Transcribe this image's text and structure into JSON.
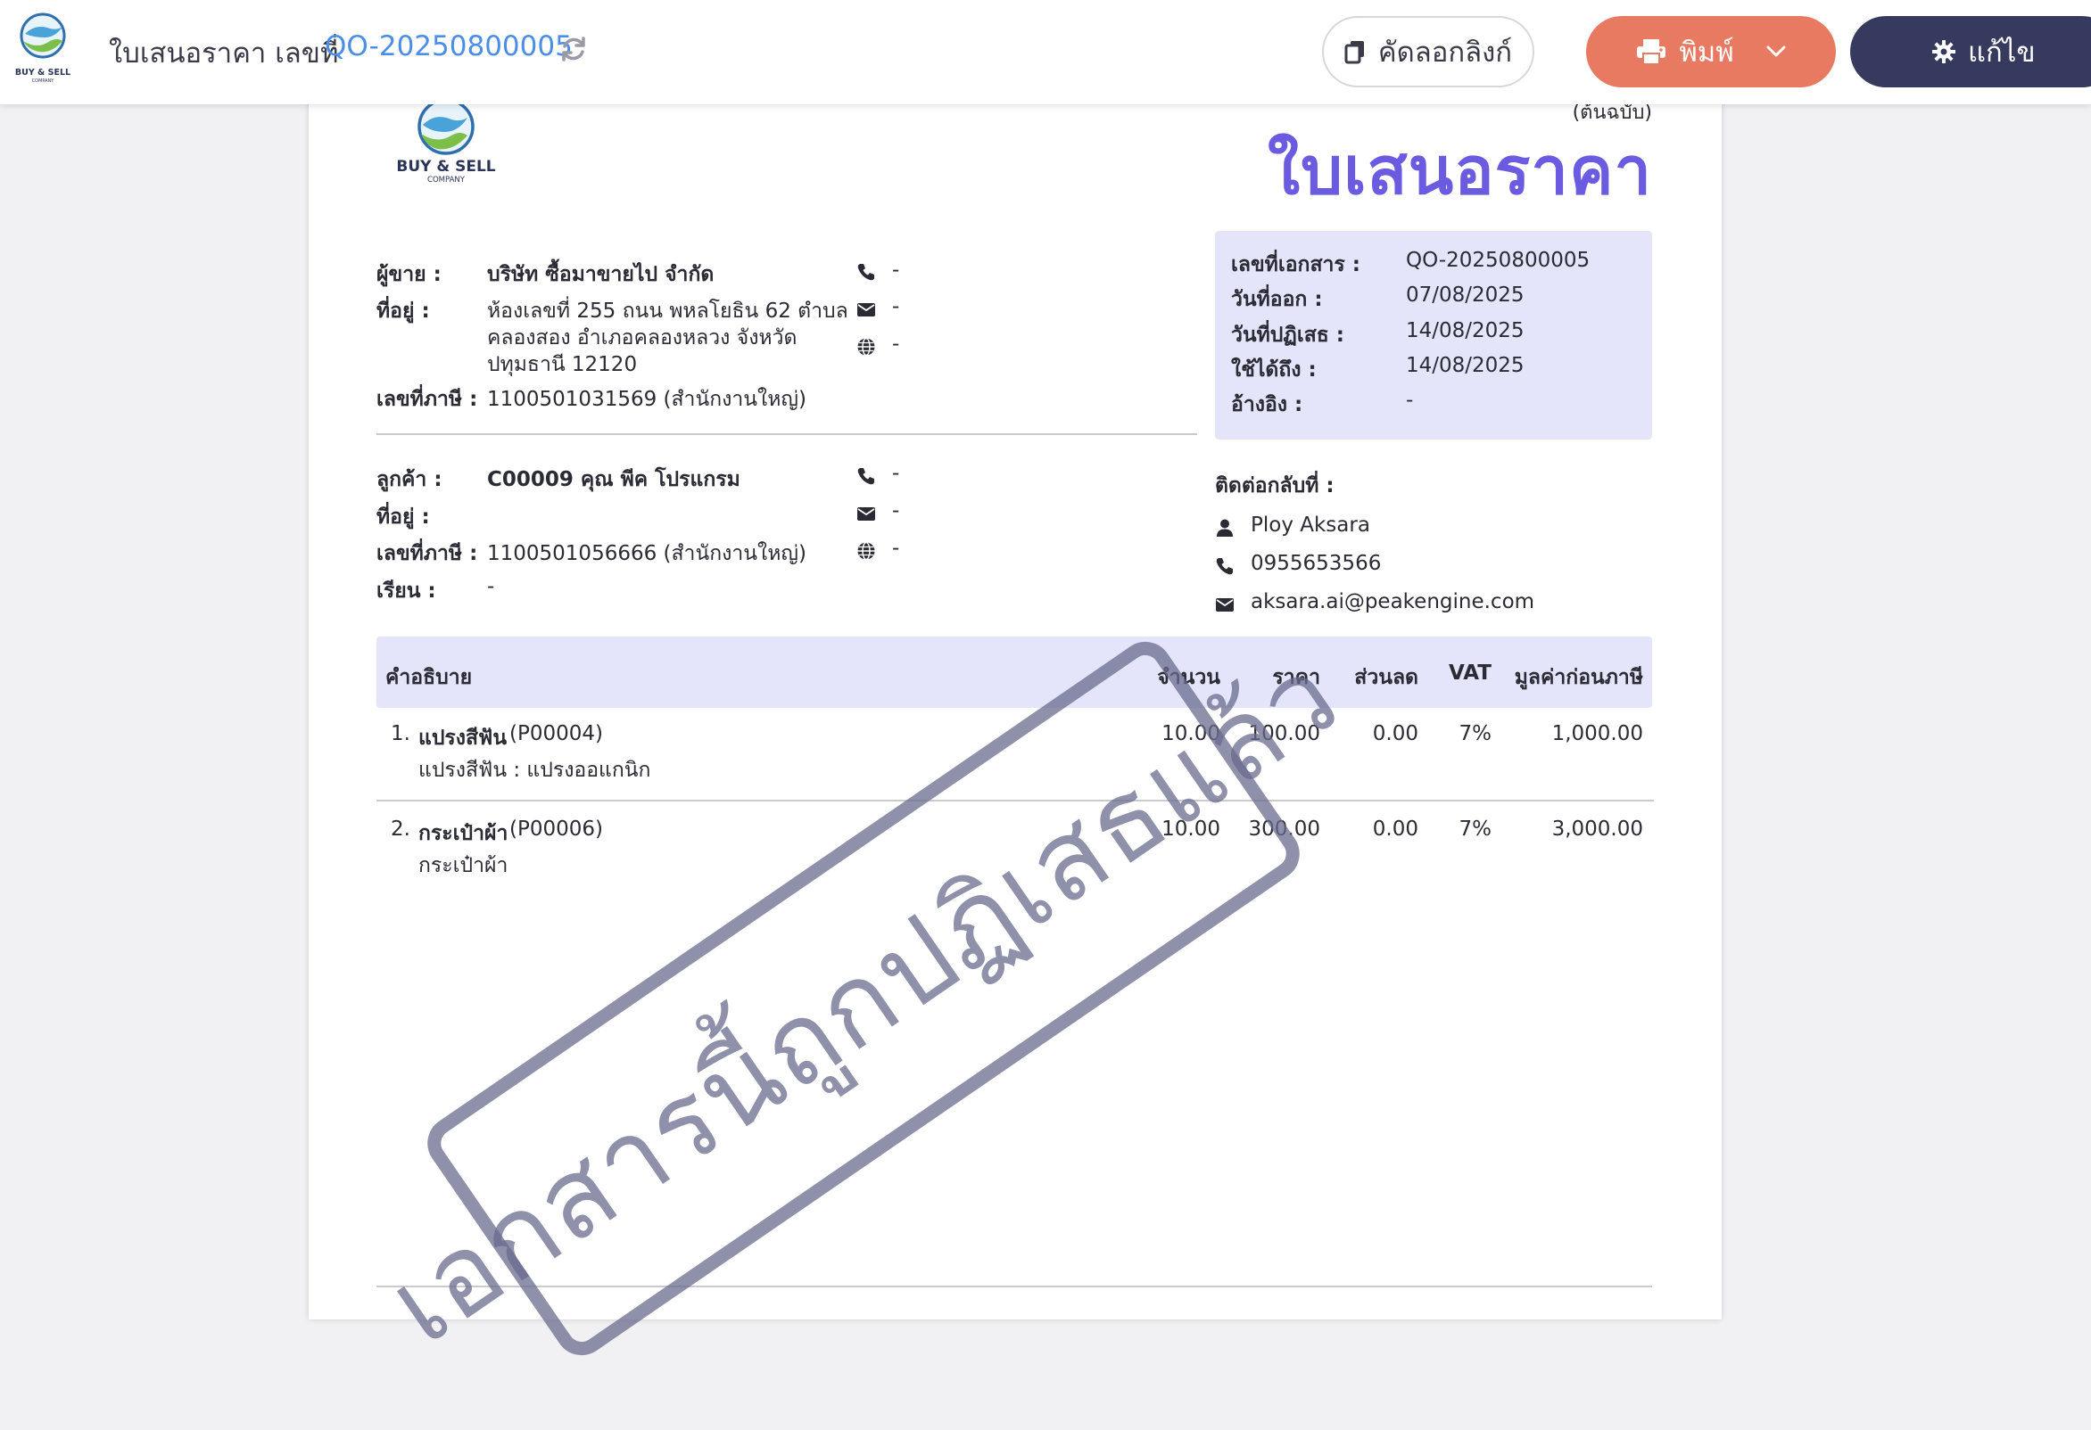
{
  "topbar": {
    "title": "ใบเสนอราคา เลขที่",
    "doc_no": "QO-20250800005",
    "copy_link_label": "คัดลอกลิงก์",
    "print_label": "พิมพ์",
    "edit_label": "แก้ไข",
    "icons": [
      "company-logo",
      "refresh-icon",
      "copy-icon",
      "printer-icon",
      "chevron-down-icon",
      "gear-icon"
    ]
  },
  "company_logo": {
    "name": "BUY & SELL",
    "sub": "COMPANY"
  },
  "document": {
    "copy_note": "(ต้นฉบับ)",
    "title": "ใบเสนอราคา"
  },
  "seller": {
    "label": "ผู้ขาย :",
    "name": "บริษัท ซื้อมาขายไป จำกัด",
    "address_label": "ที่อยู่ :",
    "address_line1": "ห้องเลขที่ 255 ถนน พหลโยธิน 62 ตำบล",
    "address_line2": "คลองสอง อำเภอคลองหลวง จังหวัด",
    "address_line3": "ปทุมธานี 12120",
    "tax_label": "เลขที่ภาษี :",
    "tax_id": "1100501031569 (สำนักงานใหญ่)",
    "phone": "-",
    "email": "-",
    "web": "-"
  },
  "customer": {
    "label": "ลูกค้า :",
    "name": "C00009 คุณ พีค โปรแกรม",
    "address_label": "ที่อยู่ :",
    "tax_label": "เลขที่ภาษี :",
    "tax_id": "1100501056666 (สำนักงานใหญ่)",
    "attn_label": "เรียน :",
    "attn": "-",
    "phone": "-",
    "email": "-",
    "web": "-"
  },
  "meta": {
    "doc_no_label": "เลขที่เอกสาร :",
    "doc_no": "QO-20250800005",
    "issue_label": "วันที่ออก :",
    "issue_date": "07/08/2025",
    "reject_label": "วันที่ปฏิเสธ :",
    "reject_date": "14/08/2025",
    "valid_label": "ใช้ได้ถึง :",
    "valid_date": "14/08/2025",
    "ref_label": "อ้างอิง :",
    "ref": "-"
  },
  "contact": {
    "label": "ติดต่อกลับที่ :",
    "name": "Ploy Aksara",
    "phone": "0955653566",
    "email": "aksara.ai@peakengine.com"
  },
  "table": {
    "headers": {
      "desc": "คำอธิบาย",
      "qty": "จำนวน",
      "price": "ราคา",
      "discount": "ส่วนลด",
      "vat": "VAT",
      "amount": "มูลค่าก่อนภาษี"
    },
    "rows": [
      {
        "no": "1.",
        "name": "แปรงสีฟัน",
        "code": "(P00004)",
        "detail": "แปรงสีฟัน : แปรงออแกนิก",
        "qty": "10.00",
        "price": "100.00",
        "discount": "0.00",
        "vat": "7%",
        "amount": "1,000.00"
      },
      {
        "no": "2.",
        "name": "กระเป๋าผ้า",
        "code": "(P00006)",
        "detail": "กระเป๋าผ้า",
        "qty": "10.00",
        "price": "300.00",
        "discount": "0.00",
        "vat": "7%",
        "amount": "3,000.00"
      }
    ]
  },
  "stamp": {
    "text": "เอกสารนี้ถูกปฏิเสธแล้ว"
  },
  "colors": {
    "accent": "#4a8ee8",
    "title": "#6a5be0",
    "print": "#e87a62",
    "edit": "#353a5e",
    "panel": "#e4e5fb"
  }
}
